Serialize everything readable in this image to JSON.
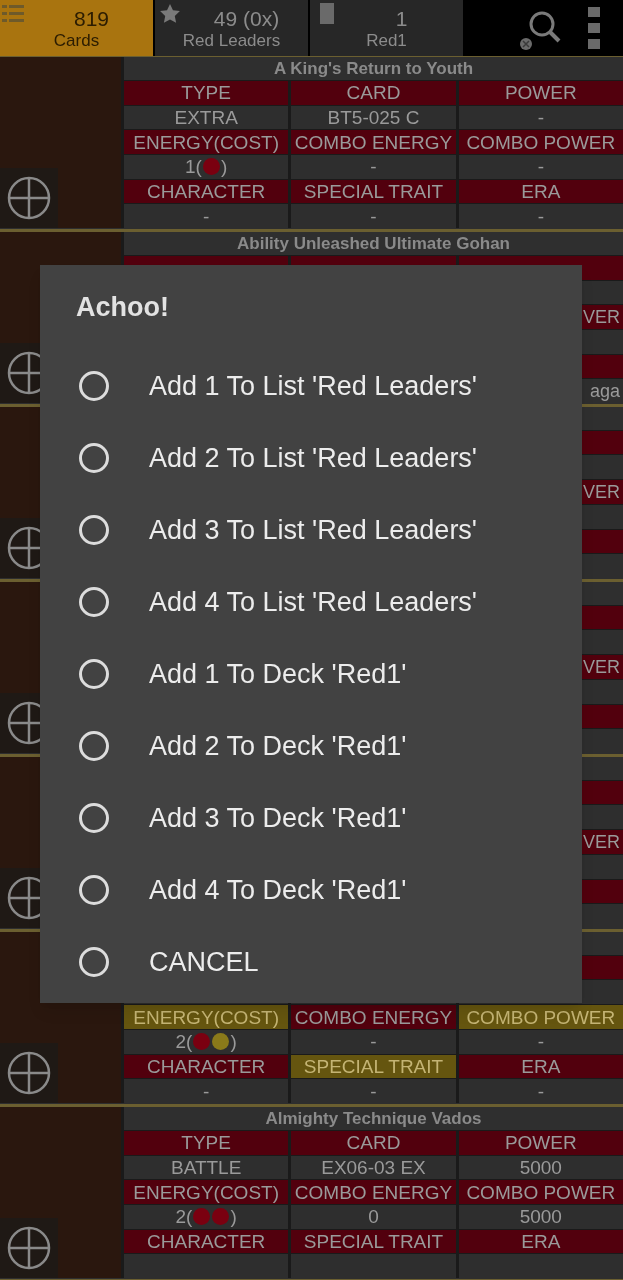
{
  "tabs": [
    {
      "kind": "list",
      "count": "819",
      "label": "Cards",
      "selected": true
    },
    {
      "kind": "star",
      "count": "49 (0x)",
      "label": "Red Leaders",
      "selected": false
    },
    {
      "kind": "card",
      "count": "1",
      "label": "Red1",
      "selected": false
    }
  ],
  "cards": [
    {
      "kind": "full",
      "title": "A King's Return to Youth",
      "type_labels": [
        {
          "text": "TYPE",
          "highlight": false
        },
        {
          "text": "CARD",
          "highlight": false
        },
        {
          "text": "POWER",
          "highlight": false
        }
      ],
      "type_values": [
        {
          "text": "EXTRA"
        },
        {
          "text": "BT5-025 C"
        },
        {
          "text": "-"
        }
      ],
      "energy_labels": [
        {
          "text": "ENERGY(COST)",
          "highlight": false
        },
        {
          "text": "COMBO ENERGY",
          "highlight": false
        },
        {
          "text": "COMBO POWER",
          "highlight": false
        }
      ],
      "energy_values": [
        {
          "text": "1(",
          "dots": [
            {
              "color": "#7a0010"
            }
          ],
          "suffix": ")"
        },
        {
          "text": "-"
        },
        {
          "text": "-"
        }
      ],
      "character_labels": [
        {
          "text": "CHARACTER",
          "highlight": false
        },
        {
          "text": "SPECIAL TRAIT",
          "highlight": false
        },
        {
          "text": "ERA",
          "highlight": false
        }
      ],
      "character_values": [
        {
          "text": "-"
        },
        {
          "text": "-"
        },
        {
          "text": "-"
        }
      ]
    },
    {
      "kind": "covered",
      "title": "Ability Unleashed Ultimate Gohan",
      "energy_labels": [
        {
          "text": "VER",
          "highlight": false
        }
      ],
      "character_values": [
        {
          "text": "aga"
        }
      ]
    },
    {
      "kind": "covered",
      "energy_labels": [
        {
          "text": "VER",
          "highlight": false
        }
      ]
    },
    {
      "kind": "covered",
      "energy_labels": [
        {
          "text": "VER",
          "highlight": false
        }
      ]
    },
    {
      "kind": "covered",
      "energy_labels": [
        {
          "text": "VER",
          "highlight": false
        }
      ]
    },
    {
      "kind": "full",
      "energy_labels": [
        {
          "text": "ENERGY(COST)",
          "highlight": true
        },
        {
          "text": "COMBO ENERGY",
          "highlight": false
        },
        {
          "text": "COMBO POWER",
          "highlight": true
        }
      ],
      "energy_values": [
        {
          "text": "2(",
          "dots": [
            {
              "color": "#7a0010"
            },
            {
              "color": "#8a7a1a"
            }
          ],
          "suffix": ")"
        },
        {
          "text": "-"
        },
        {
          "text": "-"
        }
      ],
      "character_labels": [
        {
          "text": "CHARACTER",
          "highlight": false
        },
        {
          "text": "SPECIAL TRAIT",
          "highlight": true
        },
        {
          "text": "ERA",
          "highlight": false
        }
      ],
      "character_values": [
        {
          "text": "-"
        },
        {
          "text": "-"
        },
        {
          "text": "-"
        }
      ]
    },
    {
      "kind": "full",
      "title": "Almighty Technique Vados",
      "type_labels": [
        {
          "text": "TYPE",
          "highlight": false
        },
        {
          "text": "CARD",
          "highlight": false
        },
        {
          "text": "POWER",
          "highlight": false
        }
      ],
      "type_values": [
        {
          "text": "BATTLE"
        },
        {
          "text": "EX06-03 EX"
        },
        {
          "text": "5000"
        }
      ],
      "energy_labels": [
        {
          "text": "ENERGY(COST)",
          "highlight": false
        },
        {
          "text": "COMBO ENERGY",
          "highlight": false
        },
        {
          "text": "COMBO POWER",
          "highlight": false
        }
      ],
      "energy_values": [
        {
          "text": "2(",
          "dots": [
            {
              "color": "#7a0010"
            },
            {
              "color": "#7a0010"
            }
          ],
          "suffix": ")"
        },
        {
          "text": "0"
        },
        {
          "text": "5000"
        }
      ],
      "character_labels": [
        {
          "text": "CHARACTER",
          "highlight": false
        },
        {
          "text": "SPECIAL TRAIT",
          "highlight": false
        },
        {
          "text": "ERA",
          "highlight": false
        }
      ]
    }
  ],
  "dialog": {
    "title": "Achoo!",
    "options": [
      {
        "label": "Add 1 To List 'Red Leaders'",
        "selected": false
      },
      {
        "label": "Add 2 To List 'Red Leaders'",
        "selected": false
      },
      {
        "label": "Add 3 To List 'Red Leaders'",
        "selected": false
      },
      {
        "label": "Add 4 To List 'Red Leaders'",
        "selected": false
      },
      {
        "label": "Add 1 To Deck 'Red1'",
        "selected": false
      },
      {
        "label": "Add 2 To Deck 'Red1'",
        "selected": false
      },
      {
        "label": "Add 3 To Deck 'Red1'",
        "selected": false
      },
      {
        "label": "Add 4 To Deck 'Red1'",
        "selected": false
      },
      {
        "label": "CANCEL",
        "selected": false
      }
    ]
  }
}
